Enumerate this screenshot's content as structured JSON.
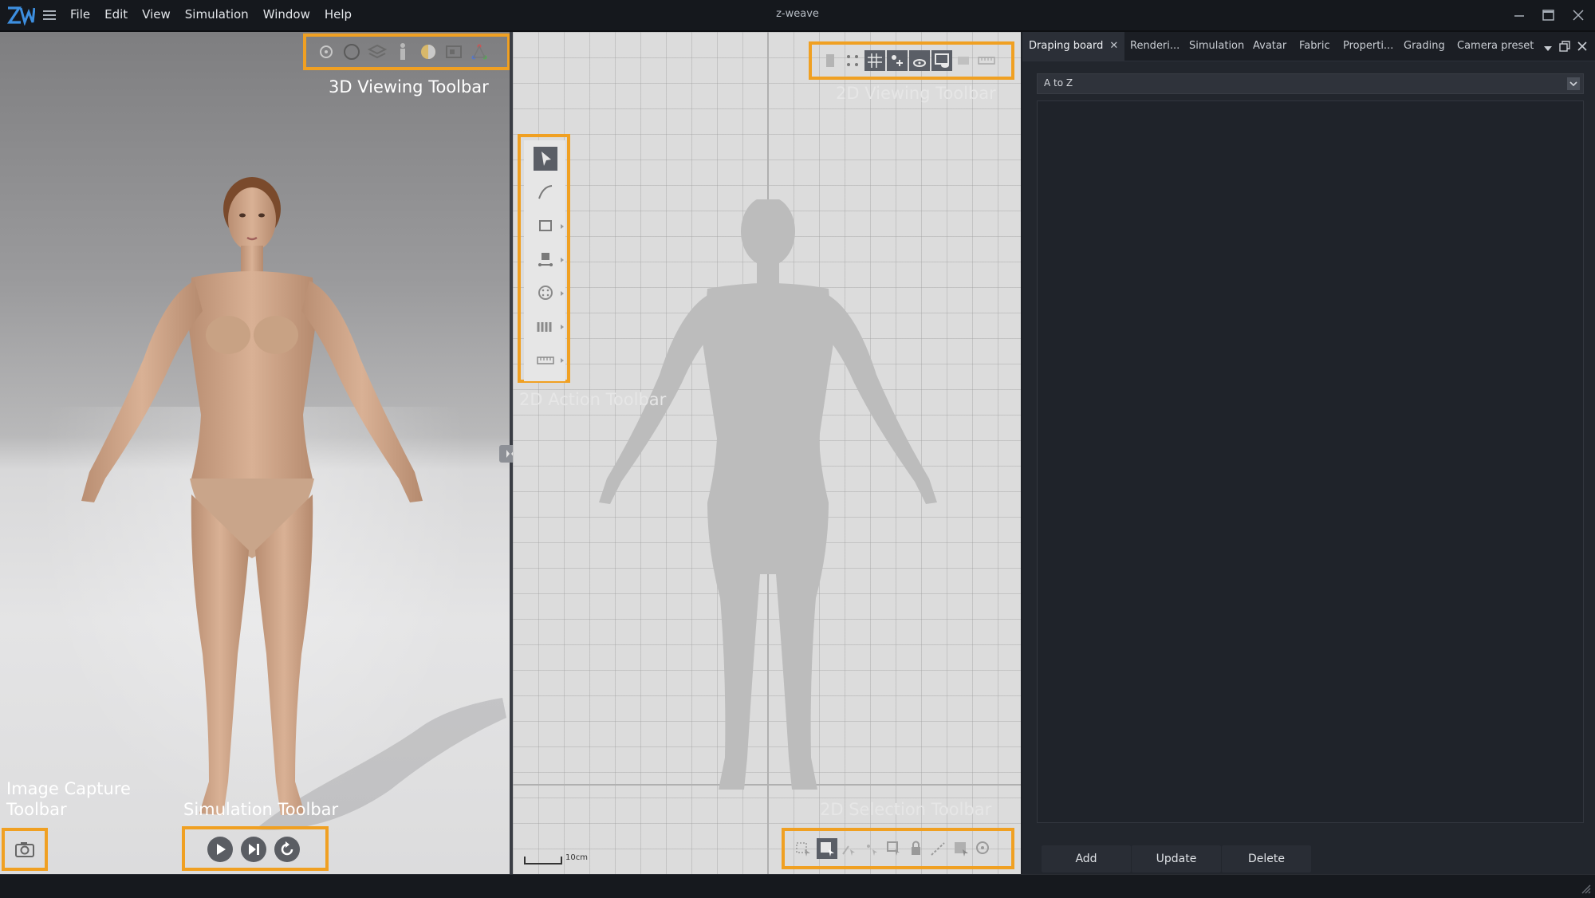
{
  "app": {
    "title": "z-weave"
  },
  "menubar": {
    "items": [
      "File",
      "Edit",
      "View",
      "Simulation",
      "Window",
      "Help"
    ]
  },
  "icons": {
    "logo": "zw-logo",
    "hamburger": "hamburger-menu-icon",
    "minimize": "minimize-icon",
    "maximize": "maximize-icon",
    "close": "close-icon",
    "camera": "camera-icon",
    "play": "play-icon",
    "step": "step-forward-icon",
    "reset": "reset-icon"
  },
  "colors": {
    "highlight": "#f0a022",
    "title_bar": "#15181d",
    "panel_bg": "#22262d",
    "grid_bg": "#dcdcdc"
  },
  "overlays": {
    "toolbar_3d": "3D Viewing Toolbar",
    "toolbar_2d_viewing": "2D Viewing Toolbar",
    "toolbar_2d_action": "2D Action Toolbar",
    "toolbar_image_capture_line1": "Image Capture",
    "toolbar_image_capture_line2": "Toolbar",
    "toolbar_simulation": "Simulation Toolbar",
    "toolbar_2d_selection": "2D Selection Toolbar"
  },
  "viewport2d": {
    "scale_label": "10cm"
  },
  "right_panel": {
    "tabs": [
      "Draping board",
      "Renderi...",
      "Simulation",
      "Avatar",
      "Fabric",
      "Properti...",
      "Grading",
      "Camera preset"
    ],
    "active_tab": "Draping board",
    "sort_value": "A to Z",
    "buttons": {
      "add": "Add",
      "update": "Update",
      "delete": "Delete"
    }
  }
}
